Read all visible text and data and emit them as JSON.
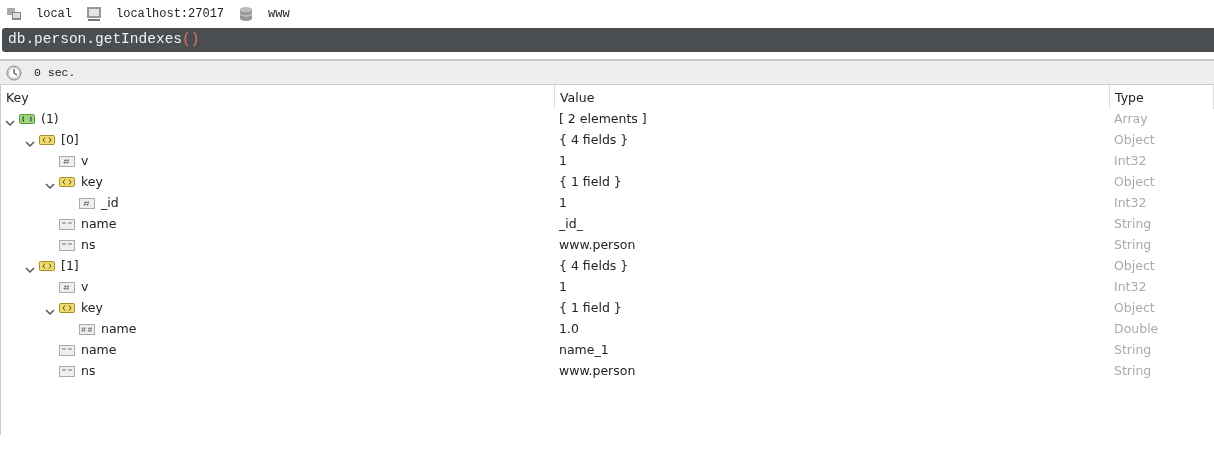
{
  "breadcrumbs": [
    {
      "kind": "connection",
      "label": "local"
    },
    {
      "kind": "server",
      "label": "localhost:27017"
    },
    {
      "kind": "database",
      "label": "www"
    }
  ],
  "query": {
    "text": "db.person.getIndexes",
    "call": "()"
  },
  "status": {
    "time": "0 sec."
  },
  "table": {
    "columns": [
      "Key",
      "Value",
      "Type"
    ],
    "rows": [
      {
        "kind": "array",
        "key": "(1)",
        "value": "[ 2 elements ]",
        "type": "Array",
        "expanded": true,
        "children": [
          {
            "kind": "object",
            "key": "[0]",
            "value": "{ 4 fields }",
            "type": "Object",
            "expanded": true,
            "children": [
              {
                "kind": "int",
                "key": "v",
                "value": "1",
                "type": "Int32"
              },
              {
                "kind": "object",
                "key": "key",
                "value": "{ 1 field }",
                "type": "Object",
                "expanded": true,
                "children": [
                  {
                    "kind": "int",
                    "key": "_id",
                    "value": "1",
                    "type": "Int32"
                  }
                ]
              },
              {
                "kind": "string",
                "key": "name",
                "value": "_id_",
                "type": "String"
              },
              {
                "kind": "string",
                "key": "ns",
                "value": "www.person",
                "type": "String"
              }
            ]
          },
          {
            "kind": "object",
            "key": "[1]",
            "value": "{ 4 fields }",
            "type": "Object",
            "expanded": true,
            "children": [
              {
                "kind": "int",
                "key": "v",
                "value": "1",
                "type": "Int32"
              },
              {
                "kind": "object",
                "key": "key",
                "value": "{ 1 field }",
                "type": "Object",
                "expanded": true,
                "children": [
                  {
                    "kind": "double",
                    "key": "name",
                    "value": "1.0",
                    "type": "Double"
                  }
                ]
              },
              {
                "kind": "string",
                "key": "name",
                "value": "name_1",
                "type": "String"
              },
              {
                "kind": "string",
                "key": "ns",
                "value": "www.person",
                "type": "String"
              }
            ]
          }
        ]
      }
    ]
  }
}
